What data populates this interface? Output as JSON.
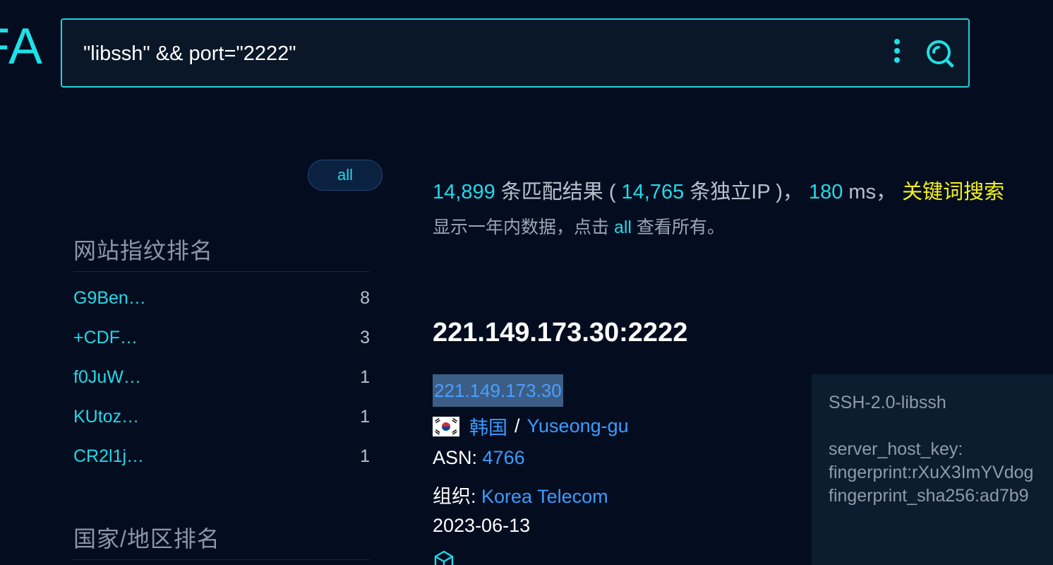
{
  "logo": {
    "text": "FA"
  },
  "search": {
    "query": "\"libssh\" && port=\"2222\"",
    "more_icon": "more-vertical-icon",
    "search_icon": "search-icon"
  },
  "sidebar": {
    "all_label": "all",
    "fingerprint_title": "网站指纹排名",
    "fingerprint_items": [
      {
        "name": "G9Ben…",
        "count": "8"
      },
      {
        "name": "+CDF…",
        "count": "3"
      },
      {
        "name": "f0JuW…",
        "count": "1"
      },
      {
        "name": "KUtoz…",
        "count": "1"
      },
      {
        "name": "CR2l1j…",
        "count": "1"
      }
    ],
    "country_title": "国家/地区排名"
  },
  "summary": {
    "total": "14,899",
    "total_suffix": " 条匹配结果 ( ",
    "unique_ip": "14,765",
    "unique_suffix": " 条独立IP )， ",
    "time": "180",
    "time_unit": " ms， ",
    "keyword_search": "关键词搜索",
    "note_prefix": "显示一年内数据，点击 ",
    "note_link": "all",
    "note_suffix": " 查看所有。"
  },
  "result": {
    "host": "221.149.173.30:2222",
    "ip": "221.149.173.30",
    "country": "韩国",
    "separator": "/",
    "city": "Yuseong-gu",
    "asn_label": "ASN: ",
    "asn": "4766",
    "org_label": "组织: ",
    "org": "Korea Telecom",
    "date": "2023-06-13",
    "banner": "SSH-2.0-libssh\n\nserver_host_key:\nfingerprint:rXuX3ImYVdog\nfingerprint_sha256:ad7b9"
  },
  "colors": {
    "accent": "#22d9e8",
    "link": "#3d9bff",
    "highlight": "#f6f31a",
    "background": "#030d1f"
  }
}
